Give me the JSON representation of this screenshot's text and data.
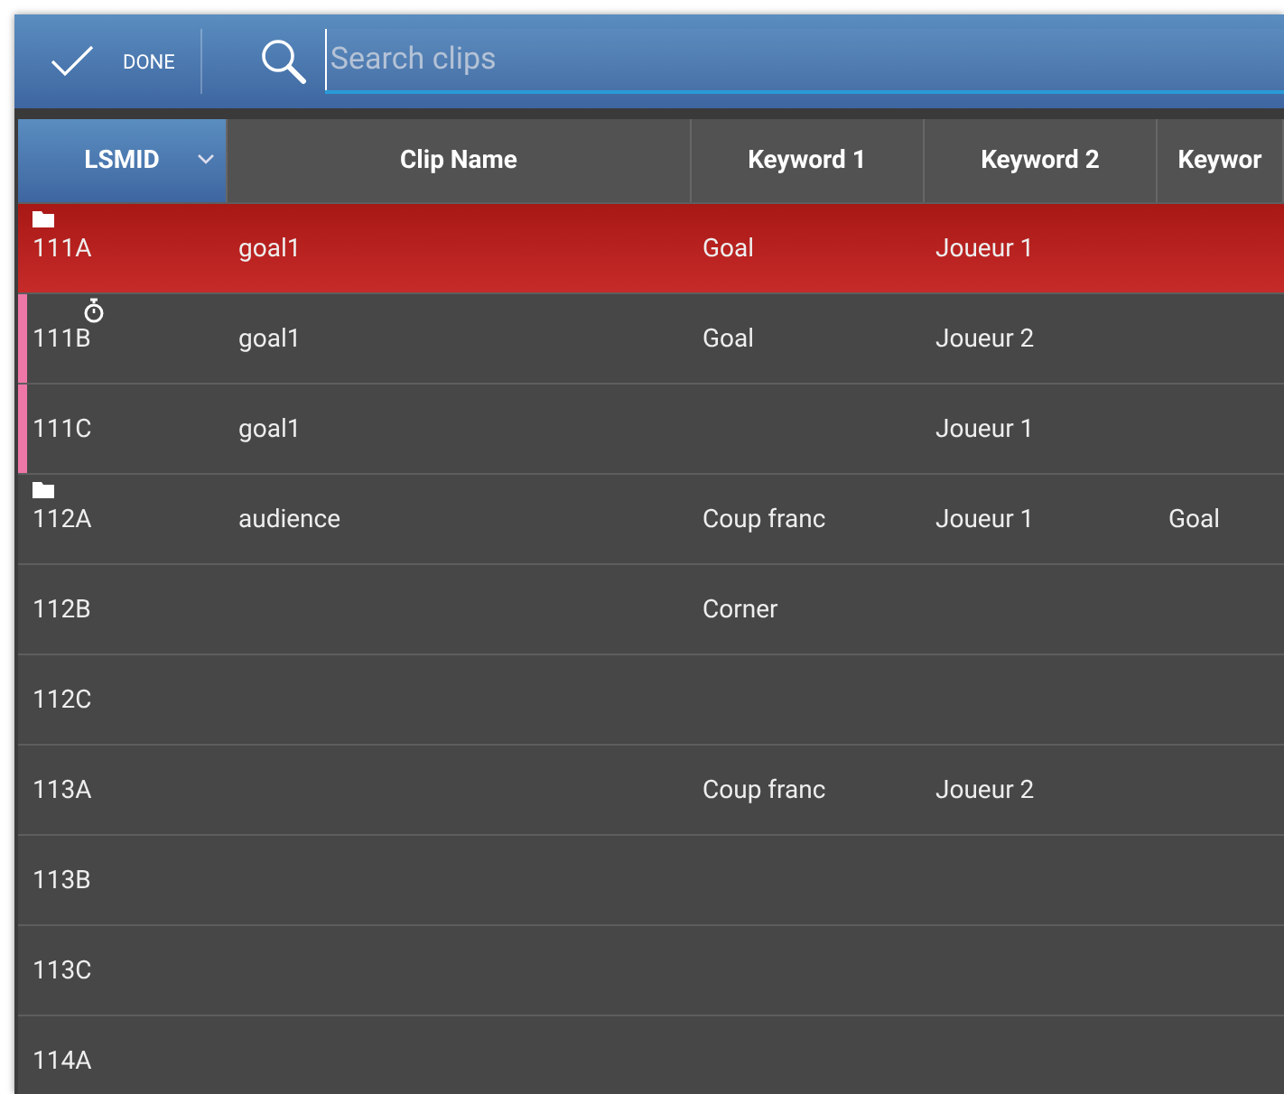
{
  "toolbar": {
    "done_label": "DONE",
    "search": {
      "placeholder": "Search clips"
    }
  },
  "table": {
    "columns": [
      {
        "label": "LSMID",
        "sorted": true
      },
      {
        "label": "Clip Name",
        "sorted": false
      },
      {
        "label": "Keyword 1",
        "sorted": false
      },
      {
        "label": "Keyword 2",
        "sorted": false
      },
      {
        "label": "Keywor",
        "sorted": false
      }
    ],
    "rows": [
      {
        "cells": [
          "111A",
          "goal1",
          "Goal",
          "Joueur 1",
          ""
        ],
        "selected": true,
        "tagged": false,
        "kind": "folder"
      },
      {
        "cells": [
          "111B",
          "goal1",
          "Goal",
          "Joueur 2",
          ""
        ],
        "selected": false,
        "tagged": true,
        "kind": "timer"
      },
      {
        "cells": [
          "111C",
          "goal1",
          "",
          "Joueur 1",
          ""
        ],
        "selected": false,
        "tagged": true,
        "kind": "plain"
      },
      {
        "cells": [
          "112A",
          "audience",
          "Coup franc",
          "Joueur 1",
          "Goal"
        ],
        "selected": false,
        "tagged": false,
        "kind": "folder"
      },
      {
        "cells": [
          "112B",
          "",
          "Corner",
          "",
          ""
        ],
        "selected": false,
        "tagged": false,
        "kind": "plain"
      },
      {
        "cells": [
          "112C",
          "",
          "",
          "",
          ""
        ],
        "selected": false,
        "tagged": false,
        "kind": "plain"
      },
      {
        "cells": [
          "113A",
          "",
          "Coup franc",
          "Joueur 2",
          ""
        ],
        "selected": false,
        "tagged": false,
        "kind": "plain"
      },
      {
        "cells": [
          "113B",
          "",
          "",
          "",
          ""
        ],
        "selected": false,
        "tagged": false,
        "kind": "plain"
      },
      {
        "cells": [
          "113C",
          "",
          "",
          "",
          ""
        ],
        "selected": false,
        "tagged": false,
        "kind": "plain"
      },
      {
        "cells": [
          "114A",
          "",
          "",
          "",
          ""
        ],
        "selected": false,
        "tagged": false,
        "kind": "plain"
      }
    ]
  }
}
